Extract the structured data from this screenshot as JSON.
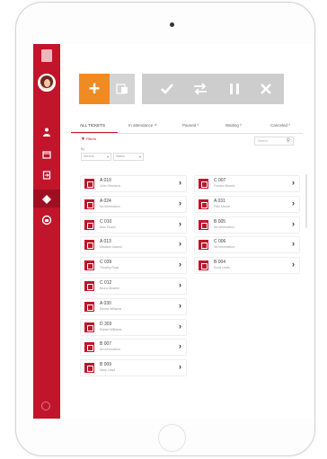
{
  "toolbar": {
    "add_icon": "plus-icon",
    "sub_icon": "document-icon",
    "action_icons": [
      "check-icon",
      "transfer-icon",
      "pause-icon",
      "close-icon"
    ]
  },
  "tabs": [
    {
      "label": "ALL TICKETS",
      "active": true
    },
    {
      "label": "In attendance ¹²",
      "active": false
    },
    {
      "label": "Paused ³",
      "active": false
    },
    {
      "label": "Waiting ²",
      "active": false
    },
    {
      "label": "Canceled ²",
      "active": false
    }
  ],
  "filter": {
    "label": "Filters",
    "by_label": "By",
    "dropdown1": "Service",
    "dropdown2": "Status"
  },
  "search": {
    "placeholder": "Search"
  },
  "tickets_left": [
    {
      "code": "A 010",
      "name": "John Simmons"
    },
    {
      "code": "A 024",
      "name": "No information"
    },
    {
      "code": "C 010",
      "name": "Alan Evans"
    },
    {
      "code": "A 013",
      "name": "Madison Adams"
    },
    {
      "code": "C 039",
      "name": "Timothy Ross"
    },
    {
      "code": "C 012",
      "name": "Bruno Alvarez"
    },
    {
      "code": "A 030",
      "name": "Emma Williams"
    },
    {
      "code": "D 303",
      "name": "Robert Williams"
    },
    {
      "code": "B 007",
      "name": "No information"
    },
    {
      "code": "B 009",
      "name": "Mary Lloyd"
    }
  ],
  "tickets_right": [
    {
      "code": "C 007",
      "name": "Gordon Brooks"
    },
    {
      "code": "A 031",
      "name": "Paul Moore"
    },
    {
      "code": "B 005",
      "name": "No information"
    },
    {
      "code": "C 006",
      "name": "No information"
    },
    {
      "code": "B 004",
      "name": "Scott Lewis"
    }
  ],
  "colors": {
    "brand": "#c0152b",
    "accent": "#f08a22",
    "inactive": "#cdcdcd"
  },
  "sidebar": {
    "icons": [
      "logo-icon",
      "person-icon",
      "calendar-icon",
      "exit-icon",
      "ticket-icon",
      "support-icon",
      "power-icon"
    ]
  }
}
